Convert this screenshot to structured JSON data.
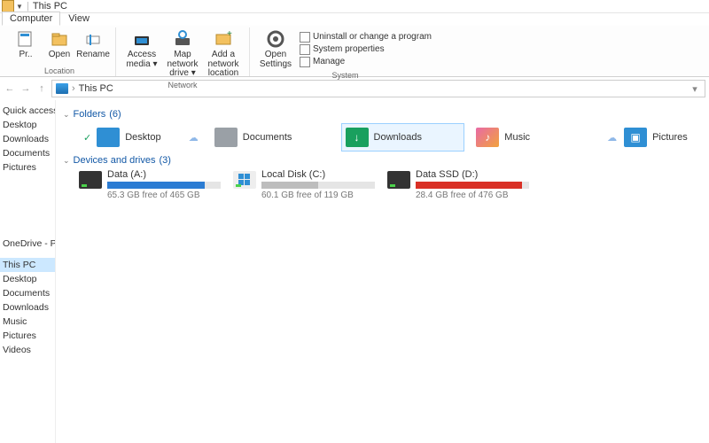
{
  "window": {
    "title": "This PC"
  },
  "ribbon": {
    "tabs": {
      "computer": "Computer",
      "view": "View"
    },
    "location": {
      "properties": "Pr..",
      "open": "Open",
      "rename": "Rename",
      "group_label": "Location"
    },
    "network": {
      "access_media": "Access media ▾",
      "map_drive": "Map network drive ▾",
      "add_location": "Add a network location",
      "group_label": "Network"
    },
    "system": {
      "open_settings": "Open Settings",
      "uninstall": "Uninstall or change a program",
      "sys_properties": "System properties",
      "manage": "Manage",
      "group_label": "System"
    }
  },
  "address": {
    "root": "This PC",
    "back": "←",
    "fwd": "→",
    "up": "↑",
    "sep": "›",
    "refresh": "⟳",
    "drop": "▾"
  },
  "sidebar": {
    "quick": "Quick access",
    "desktop": "Desktop",
    "downloads": "Downloads",
    "documents": "Documents",
    "pictures": "Pictures",
    "onedrive": "OneDrive - Personal",
    "thispc": "This PC",
    "pc_desktop": "Desktop",
    "pc_documents": "Documents",
    "pc_downloads": "Downloads",
    "pc_music": "Music",
    "pc_pictures": "Pictures",
    "pc_videos": "Videos"
  },
  "groups": {
    "folders": {
      "label": "Folders",
      "count": "(6)"
    },
    "drives": {
      "label": "Devices and drives",
      "count": "(3)"
    }
  },
  "folders": {
    "desktop": "Desktop",
    "documents": "Documents",
    "downloads": "Downloads",
    "music": "Music",
    "pictures": "Pictures"
  },
  "drives": {
    "a": {
      "name": "Data (A:)",
      "free": "65.3 GB free of 465 GB",
      "used_pct": 86,
      "color": "#2b7cd3"
    },
    "c": {
      "name": "Local Disk (C:)",
      "free": "60.1 GB free of 119 GB",
      "used_pct": 50,
      "color": "#bdbdbd"
    },
    "d": {
      "name": "Data SSD (D:)",
      "free": "28.4 GB free of 476 GB",
      "used_pct": 94,
      "color": "#d93025"
    }
  },
  "icons": {
    "cloud": "☁",
    "check": "✓",
    "note": "♪",
    "image": "▣",
    "down": "↓"
  }
}
